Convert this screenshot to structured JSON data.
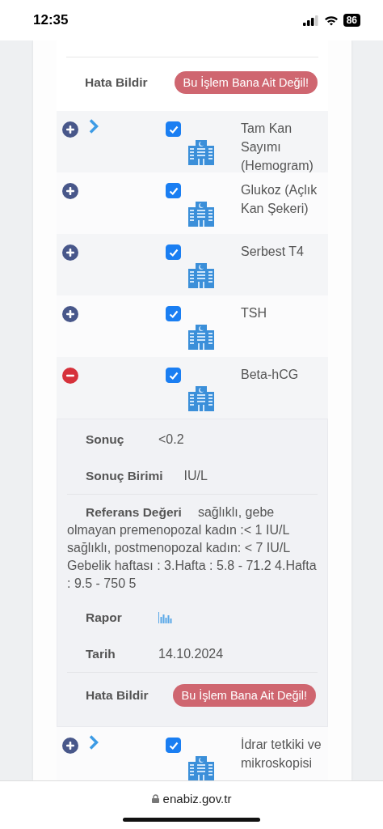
{
  "status_bar": {
    "time": "12:35",
    "battery": "86"
  },
  "top_section": {
    "report_label": "Hata Bildir",
    "report_button": "Bu İşlem Bana Ait Değil!"
  },
  "tests": [
    {
      "name": "Tam Kan Sayımı (Hemogram)",
      "expanded": false,
      "chevron": true,
      "checked": true
    },
    {
      "name": "Glukoz (Açlık Kan Şekeri)",
      "expanded": false,
      "chevron": false,
      "checked": true
    },
    {
      "name": "Serbest T4",
      "expanded": false,
      "chevron": false,
      "checked": true
    },
    {
      "name": "TSH",
      "expanded": false,
      "chevron": false,
      "checked": true
    },
    {
      "name": "Beta-hCG",
      "expanded": true,
      "chevron": false,
      "checked": true,
      "details": [
        {
          "kind": "text",
          "label": "Sonuç",
          "value": "<0.2"
        },
        {
          "kind": "text",
          "label": "Sonuç Birimi",
          "value": "IU/L"
        },
        {
          "kind": "reference",
          "label": "Referans Değeri",
          "value": "sağlıklı, gebe olmayan premenopozal kadın :< 1 IU/L sağlıklı, postmenopozal kadın: < 7 IU/L Gebelik haftası : 3.Hafta : 5.8 - 71.2 4.Hafta : 9.5 - 750 5"
        },
        {
          "kind": "chart",
          "label": "Rapor"
        },
        {
          "kind": "text",
          "label": "Tarih",
          "value": "14.10.2024"
        },
        {
          "kind": "report",
          "label": "Hata Bildir",
          "value": "Bu İşlem Bana Ait Değil!"
        }
      ]
    },
    {
      "name": "İdrar tetkiki ve mikroskopisi",
      "expanded": false,
      "chevron": true,
      "checked": true
    }
  ],
  "browser": {
    "url": "enabiz.gov.tr"
  }
}
